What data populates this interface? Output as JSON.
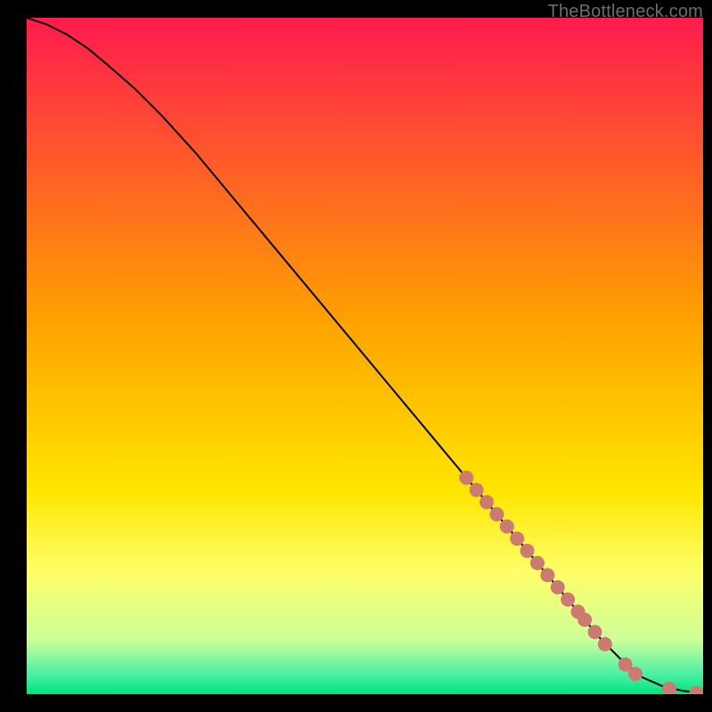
{
  "watermark": "TheBottleneck.com",
  "chart_data": {
    "type": "line",
    "title": "",
    "xlabel": "",
    "ylabel": "",
    "xlim": [
      0,
      100
    ],
    "ylim": [
      0,
      100
    ],
    "grid": false,
    "legend": false,
    "background_gradient": {
      "top_color": "#ff1b4e",
      "mid_color": "#ffde00",
      "bottom_color": "#00e47a",
      "stops": [
        {
          "pos": 0.0,
          "color": "#ff1b4e"
        },
        {
          "pos": 0.45,
          "color": "#ffa200"
        },
        {
          "pos": 0.7,
          "color": "#ffe600"
        },
        {
          "pos": 0.82,
          "color": "#ffff6a"
        },
        {
          "pos": 0.92,
          "color": "#ccff99"
        },
        {
          "pos": 0.97,
          "color": "#4cf0a4"
        },
        {
          "pos": 1.0,
          "color": "#00e47a"
        }
      ]
    },
    "series": [
      {
        "name": "curve",
        "stroke": "#000000",
        "stroke_width": 2,
        "x": [
          0,
          3,
          6,
          9,
          12,
          16,
          20,
          25,
          30,
          35,
          40,
          45,
          50,
          55,
          60,
          65,
          70,
          75,
          80,
          85,
          88,
          91,
          94,
          97,
          100
        ],
        "y": [
          100,
          99,
          97.5,
          95.5,
          93,
          89.5,
          85.5,
          80,
          74,
          68,
          62,
          56,
          50,
          44,
          38,
          32,
          26,
          20,
          14,
          8,
          5,
          2.5,
          1.2,
          0.5,
          0.2
        ]
      }
    ],
    "markers": {
      "name": "highlighted-segment",
      "color": "#cd7a72",
      "radius": 8,
      "points": [
        {
          "x": 65,
          "y": 32
        },
        {
          "x": 66.5,
          "y": 30.2
        },
        {
          "x": 68,
          "y": 28.4
        },
        {
          "x": 69.5,
          "y": 26.6
        },
        {
          "x": 71,
          "y": 24.8
        },
        {
          "x": 72.5,
          "y": 23
        },
        {
          "x": 74,
          "y": 21.2
        },
        {
          "x": 75.5,
          "y": 19.4
        },
        {
          "x": 77,
          "y": 17.6
        },
        {
          "x": 78.5,
          "y": 15.8
        },
        {
          "x": 80,
          "y": 14
        },
        {
          "x": 81.5,
          "y": 12.2
        },
        {
          "x": 82.5,
          "y": 11
        },
        {
          "x": 84,
          "y": 9.2
        },
        {
          "x": 85.5,
          "y": 7.4
        },
        {
          "x": 88.5,
          "y": 4.4
        },
        {
          "x": 90,
          "y": 3
        },
        {
          "x": 95,
          "y": 0.8
        },
        {
          "x": 99,
          "y": 0.2
        }
      ]
    }
  }
}
